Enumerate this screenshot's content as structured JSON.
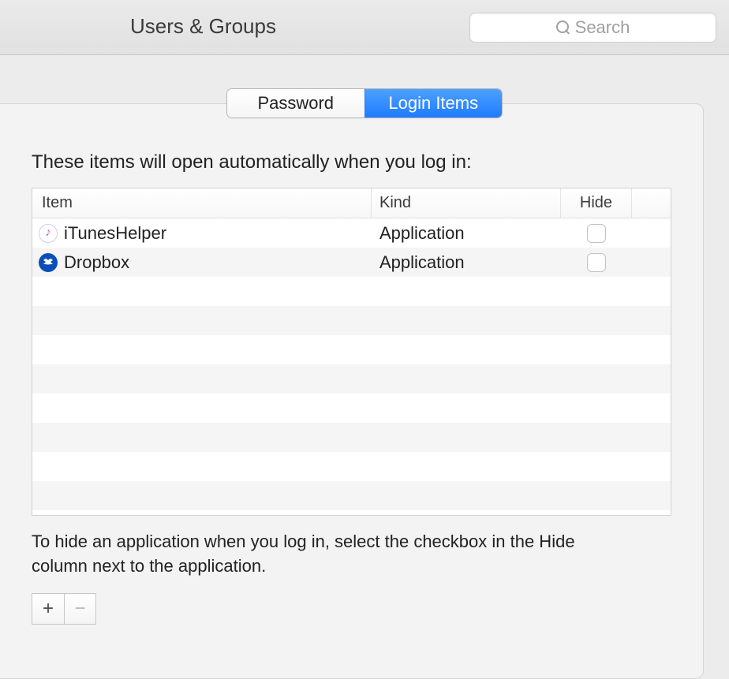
{
  "toolbar": {
    "title": "Users & Groups",
    "search_placeholder": "Search"
  },
  "tabs": {
    "password_label": "Password",
    "login_items_label": "Login Items"
  },
  "login_items": {
    "intro": "These items will open automatically when you log in:",
    "columns": {
      "item": "Item",
      "kind": "Kind",
      "hide": "Hide"
    },
    "rows": [
      {
        "icon": "itunes",
        "name": "iTunesHelper",
        "kind": "Application",
        "hide": false
      },
      {
        "icon": "dropbox",
        "name": "Dropbox",
        "kind": "Application",
        "hide": false
      }
    ],
    "hint": "To hide an application when you log in, select the checkbox in the Hide column next to the application.",
    "add_label": "+",
    "remove_label": "−"
  }
}
